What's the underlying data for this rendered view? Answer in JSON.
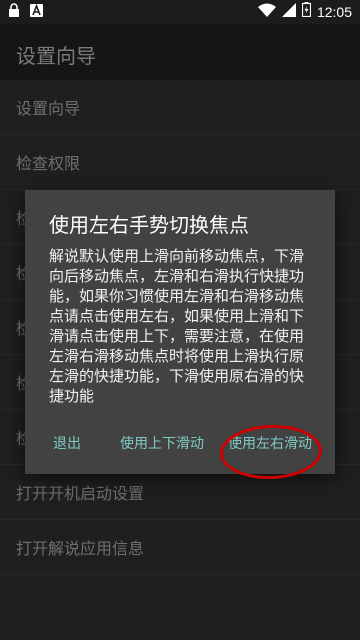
{
  "status_bar": {
    "time": "12:05",
    "left_icons": [
      "lock-icon",
      "a-box-icon"
    ],
    "right_icons": [
      "wifi-icon",
      "signal-icon",
      "battery-icon"
    ]
  },
  "app_bar": {
    "title": "设置向导"
  },
  "list_items": [
    "设置向导",
    "检查权限",
    "检",
    "检",
    "检",
    "检",
    "检",
    "打开开机启动设置",
    "打开解说应用信息"
  ],
  "dialog": {
    "title": "使用左右手势切换焦点",
    "body": "解说默认使用上滑向前移动焦点，下滑向后移动焦点，左滑和右滑执行快捷功能，如果你习惯使用左滑和右滑移动焦点请点击使用左右，如果使用上滑和下滑请点击使用上下，需要注意，在使用左滑右滑移动焦点时将使用上滑执行原左滑的快捷功能，下滑使用原右滑的快捷功能",
    "buttons": {
      "exit": "退出",
      "use_updown": "使用上下滑动",
      "use_leftright": "使用左右滑动"
    }
  },
  "colors": {
    "background": "#303030",
    "app_bar": "#212121",
    "dialog": "#424242",
    "accent": "#80cbc4",
    "annotation": "#d10000"
  }
}
